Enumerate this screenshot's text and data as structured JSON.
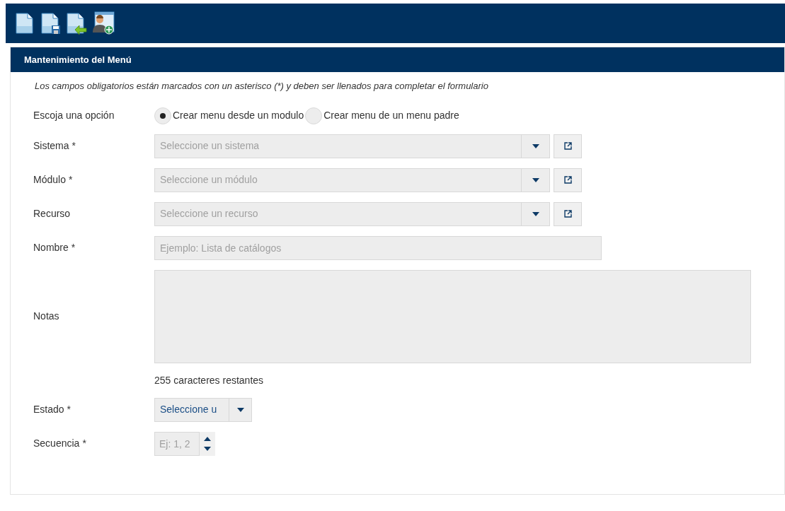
{
  "toolbar": {
    "buttons": [
      {
        "kind": "new"
      },
      {
        "kind": "save"
      },
      {
        "kind": "back"
      },
      {
        "kind": "user"
      }
    ]
  },
  "panel": {
    "title": "Mantenimiento del Menú",
    "note": "Los campos obligatorios están marcados con un asterisco (*) y deben ser llenados para completar el formulario"
  },
  "fields": [
    {
      "kind": "radio",
      "label": "Escoja una opción",
      "options": [
        {
          "label": "Crear menu desde un modulo",
          "selected": true
        },
        {
          "label": "Crear menu de un menu padre",
          "selected": false
        }
      ]
    },
    {
      "kind": "select",
      "label": "Sistema",
      "required": "*",
      "placeholder": "Seleccione un sistema"
    },
    {
      "kind": "select",
      "label": "Módulo",
      "required": "*",
      "placeholder": "Seleccione un módulo"
    },
    {
      "kind": "select",
      "label": "Recurso",
      "placeholder": "Seleccione un recurso"
    },
    {
      "kind": "text",
      "label": "Nombre",
      "required": "*",
      "placeholder": "Ejemplo: Lista de catálogos"
    },
    {
      "kind": "textarea",
      "label": "Notas",
      "counter": "255 caracteres restantes"
    },
    {
      "kind": "small-select",
      "label": "Estado",
      "required": "*",
      "value": "Seleccione u"
    },
    {
      "kind": "spinner",
      "label": "Secuencia",
      "required": "*",
      "placeholder": "Ej: 1, 2"
    }
  ]
}
